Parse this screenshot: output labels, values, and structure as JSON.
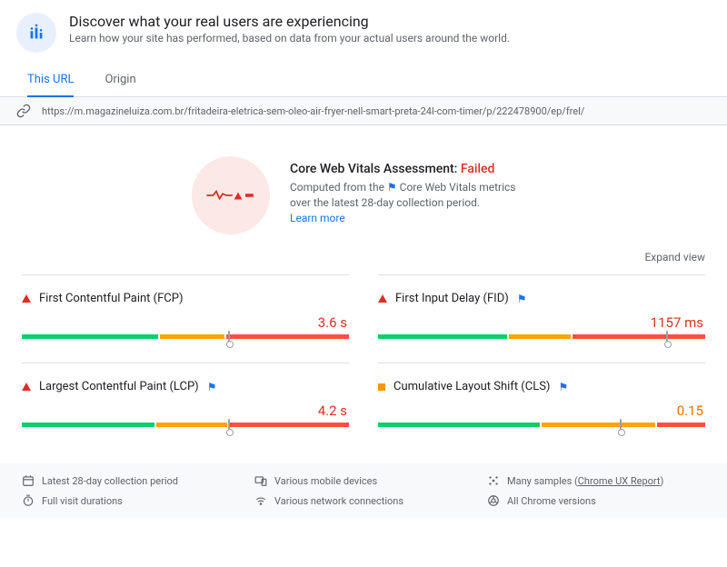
{
  "header": {
    "title": "Discover what your real users are experiencing",
    "subtitle": "Learn how your site has performed, based on data from your actual users around the world."
  },
  "tabs": {
    "this_url": "This URL",
    "origin": "Origin"
  },
  "url": "https://m.magazineluiza.com.br/fritadeira-eletrica-sem-oleo-air-fryer-nell-smart-preta-24l-com-timer/p/222478900/ep/frel/",
  "assessment": {
    "title_prefix": "Core Web Vitals Assessment: ",
    "status": "Failed",
    "desc_1": "Computed from the ",
    "desc_2": "Core Web Vitals metrics over the latest 28-day collection period.",
    "learn_more": "Learn more"
  },
  "expand_view": "Expand view",
  "metrics": {
    "fcp": {
      "name": "First Contentful Paint (FCP)",
      "value": "3.6 s",
      "status": "red",
      "core_vital": false,
      "bar": {
        "green": 42,
        "orange": 20,
        "red": 38,
        "pointer": 63
      }
    },
    "fid": {
      "name": "First Input Delay (FID)",
      "value": "1157 ms",
      "status": "red",
      "core_vital": true,
      "bar": {
        "green": 40,
        "orange": 19,
        "red": 41,
        "pointer": 88
      }
    },
    "lcp": {
      "name": "Largest Contentful Paint (LCP)",
      "value": "4.2 s",
      "status": "red",
      "core_vital": true,
      "bar": {
        "green": 41,
        "orange": 22,
        "red": 37,
        "pointer": 63
      }
    },
    "cls": {
      "name": "Cumulative Layout Shift (CLS)",
      "value": "0.15",
      "status": "orange",
      "core_vital": true,
      "bar": {
        "green": 50,
        "orange": 35,
        "red": 15,
        "pointer": 74
      }
    }
  },
  "footer": {
    "period": "Latest 28-day collection period",
    "devices": "Various mobile devices",
    "samples": "Many samples",
    "samples_link": "Chrome UX Report",
    "durations": "Full visit durations",
    "connections": "Various network connections",
    "versions": "All Chrome versions"
  }
}
